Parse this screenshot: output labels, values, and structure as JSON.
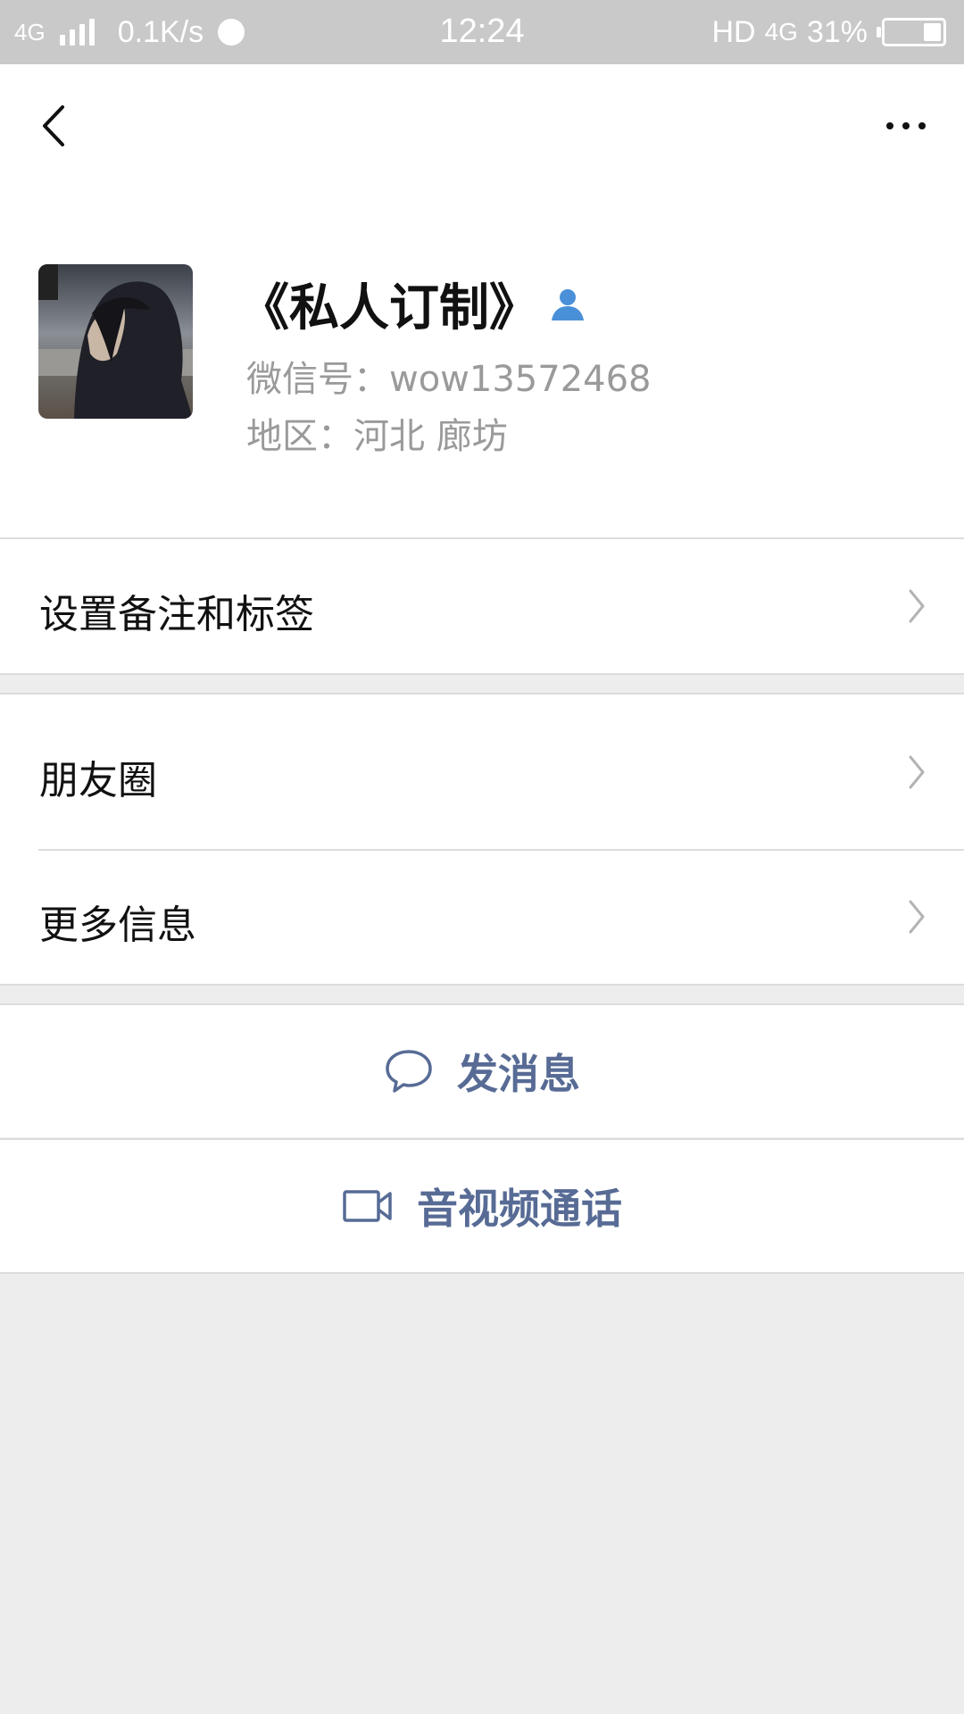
{
  "status_bar": {
    "network": "4G",
    "speed": "0.1K/s",
    "time": "12:24",
    "hd": "HD",
    "network2": "4G",
    "battery": "31%",
    "battery_level": 0.31
  },
  "icons": {
    "back": "chevron-left-icon",
    "more": "more-dots-icon",
    "contact": "contact-person-icon",
    "chevron": "chevron-right-icon",
    "message": "chat-bubble-icon",
    "video": "video-camera-icon"
  },
  "colors": {
    "link_blue": "#576b95",
    "contact_icon": "#4a90d9",
    "background": "#ededed"
  },
  "profile": {
    "name": "《私人订制》",
    "wechat_id": "微信号：wow13572468",
    "region": "地区：河北  廊坊"
  },
  "menu": {
    "remark_tags": "设置备注和标签",
    "moments": "朋友圈",
    "more_info": "更多信息"
  },
  "actions": {
    "send_message": "发消息",
    "video_call": "音视频通话"
  }
}
